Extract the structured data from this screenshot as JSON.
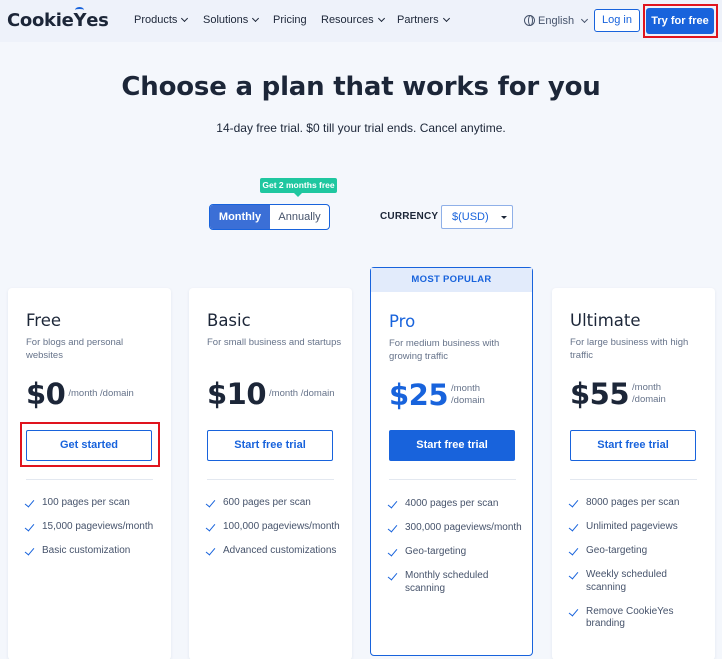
{
  "brand": {
    "logo_text_a": "Cookie",
    "logo_text_y": "Y",
    "logo_text_b": "es"
  },
  "nav": {
    "items": [
      {
        "label": "Products",
        "has_dropdown": true
      },
      {
        "label": "Solutions",
        "has_dropdown": true
      },
      {
        "label": "Pricing",
        "has_dropdown": false
      },
      {
        "label": "Resources",
        "has_dropdown": true
      },
      {
        "label": "Partners",
        "has_dropdown": true
      }
    ],
    "language": "English",
    "login_label": "Log in",
    "try_label": "Try for free"
  },
  "hero": {
    "title": "Choose a plan that works for you",
    "subtitle": "14-day free trial. $0 till your trial ends. Cancel anytime."
  },
  "billing": {
    "promo": "Get 2 months free",
    "monthly_label": "Monthly",
    "annually_label": "Annually",
    "selected": "Monthly",
    "currency_label": "CURRENCY",
    "currency_value": "$(USD)"
  },
  "plans": [
    {
      "name": "Free",
      "description": "For blogs and personal websites",
      "price": "$0",
      "unit": "/month /domain",
      "cta": "Get started",
      "features": [
        "100 pages per scan",
        "15,000 pageviews/month",
        "Basic customization"
      ]
    },
    {
      "name": "Basic",
      "description": "For small business and startups",
      "price": "$10",
      "unit": "/month /domain",
      "cta": "Start free trial",
      "features": [
        "600 pages per scan",
        "100,000 pageviews/month",
        "Advanced customizations"
      ]
    },
    {
      "name": "Pro",
      "badge": "MOST POPULAR",
      "description": "For medium business with growing traffic",
      "price": "$25",
      "unit": "/month /domain",
      "cta": "Start free trial",
      "features": [
        "4000 pages per scan",
        "300,000 pageviews/month",
        "Geo-targeting",
        "Monthly scheduled scanning"
      ]
    },
    {
      "name": "Ultimate",
      "description": "For large business with high traffic",
      "price": "$55",
      "unit": "/month /domain",
      "cta": "Start free trial",
      "features": [
        "8000 pages per scan",
        "Unlimited pageviews",
        "Geo-targeting",
        "Weekly scheduled scanning",
        "Remove CookieYes branding"
      ]
    }
  ],
  "colors": {
    "accent": "#1863dc",
    "highlight_outline": "#e0141e",
    "promo_badge": "#1fc7a0",
    "text_dark": "#1c2638",
    "text_muted": "#66738a"
  }
}
